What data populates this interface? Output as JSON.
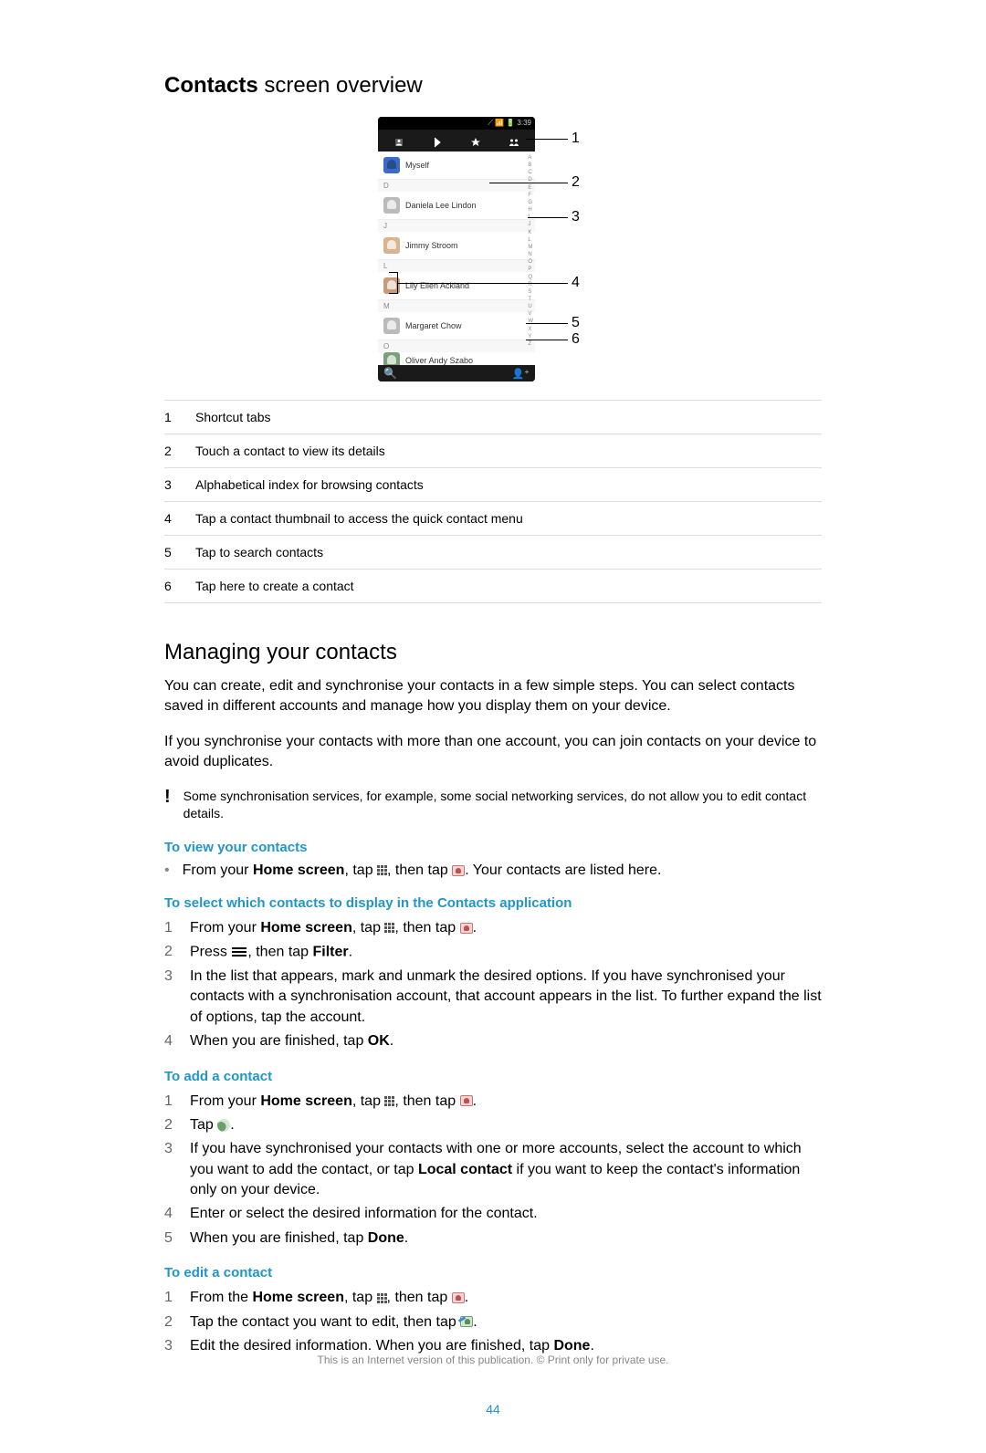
{
  "heading1": {
    "bold": "Contacts",
    "rest": " screen overview"
  },
  "phone": {
    "status_time": "3:39",
    "myself": "Myself",
    "sections": [
      "D",
      "J",
      "L",
      "M",
      "O"
    ],
    "contacts": [
      "Daniela Lee Lindon",
      "Jimmy Stroom",
      "Lily Ellen Ackland",
      "Margaret Chow",
      "Oliver Andy Szabo"
    ],
    "alpha_index": [
      "A",
      "B",
      "C",
      "D",
      "E",
      "F",
      "G",
      "H",
      "I",
      "J",
      "K",
      "L",
      "M",
      "N",
      "O",
      "P",
      "Q",
      "R",
      "S",
      "T",
      "U",
      "V",
      "W",
      "X",
      "Y",
      "Z"
    ]
  },
  "callouts": {
    "n1": "1",
    "n2": "2",
    "n3": "3",
    "n4": "4",
    "n5": "5",
    "n6": "6"
  },
  "legend": {
    "r1": {
      "num": "1",
      "text": "Shortcut tabs"
    },
    "r2": {
      "num": "2",
      "text": "Touch a contact to view its details"
    },
    "r3": {
      "num": "3",
      "text": "Alphabetical index for browsing contacts"
    },
    "r4": {
      "num": "4",
      "text": "Tap a contact thumbnail to access the quick contact menu"
    },
    "r5": {
      "num": "5",
      "text": "Tap to search contacts"
    },
    "r6": {
      "num": "6",
      "text": "Tap here to create a contact"
    }
  },
  "heading2": "Managing your contacts",
  "para1": "You can create, edit and synchronise your contacts in a few simple steps. You can select contacts saved in different accounts and manage how you display them on your device.",
  "para2": "If you synchronise your contacts with more than one account, you can join contacts on your device to avoid duplicates.",
  "note1": "Some synchronisation services, for example, some social networking services, do not allow you to edit contact details.",
  "view": {
    "head": "To view your contacts",
    "l1a": "From your ",
    "l1b": "Home screen",
    "l1c": ", tap ",
    "l1d": ", then tap ",
    "l1e": ". Your contacts are listed here."
  },
  "select": {
    "head": "To select which contacts to display in the Contacts application",
    "s1": {
      "num": "1",
      "a": "From your ",
      "b": "Home screen",
      "c": ", tap ",
      "d": ", then tap ",
      "e": "."
    },
    "s2": {
      "num": "2",
      "a": "Press ",
      "b": ", then tap ",
      "c": "Filter",
      "d": "."
    },
    "s3": {
      "num": "3",
      "text": "In the list that appears, mark and unmark the desired options. If you have synchronised your contacts with a synchronisation account, that account appears in the list. To further expand the list of options, tap the account."
    },
    "s4": {
      "num": "4",
      "a": "When you are finished, tap ",
      "b": "OK",
      "c": "."
    }
  },
  "add": {
    "head": "To add a contact",
    "s1": {
      "num": "1",
      "a": "From your ",
      "b": "Home screen",
      "c": ", tap ",
      "d": ", then tap ",
      "e": "."
    },
    "s2": {
      "num": "2",
      "a": "Tap ",
      "b": "."
    },
    "s3": {
      "num": "3",
      "a": "If you have synchronised your contacts with one or more accounts, select the account to which you want to add the contact, or tap ",
      "b": "Local contact",
      "c": " if you want to keep the contact's information only on your device."
    },
    "s4": {
      "num": "4",
      "text": "Enter or select the desired information for the contact."
    },
    "s5": {
      "num": "5",
      "a": "When you are finished, tap ",
      "b": "Done",
      "c": "."
    }
  },
  "edit": {
    "head": "To edit a contact",
    "s1": {
      "num": "1",
      "a": "From the ",
      "b": "Home screen",
      "c": ", tap ",
      "d": ", then tap ",
      "e": "."
    },
    "s2": {
      "num": "2",
      "a": "Tap the contact you want to edit, then tap ",
      "b": "."
    },
    "s3": {
      "num": "3",
      "a": "Edit the desired information. When you are finished, tap ",
      "b": "Done",
      "c": "."
    }
  },
  "page_number": "44",
  "footer": "This is an Internet version of this publication. © Print only for private use."
}
